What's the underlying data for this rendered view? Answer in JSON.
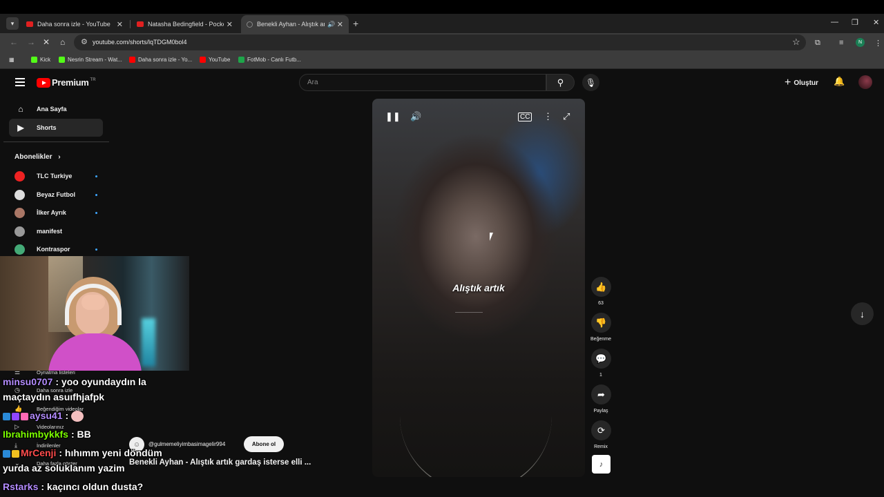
{
  "browser": {
    "tabs": [
      {
        "label": "Daha sonra izle - YouTube"
      },
      {
        "label": "Natasha Bedingfield - Pocketful"
      },
      {
        "label": "Benekli Ayhan - Alıştık artık"
      }
    ],
    "url": "youtube.com/shorts/lqTDGM0bol4",
    "profile_initial": "N",
    "bookmarks": [
      {
        "label": "Kick",
        "color": "#53fc18"
      },
      {
        "label": "Nesrin Stream - Wat...",
        "color": "#53fc18"
      },
      {
        "label": "Daha sonra izle - Yo...",
        "color": "#ff0000"
      },
      {
        "label": "YouTube",
        "color": "#ff0000"
      },
      {
        "label": "FotMob - Canlı Futb...",
        "color": "#1ea54a"
      }
    ]
  },
  "youtube": {
    "logo_text": "Premium",
    "logo_region": "TR",
    "search_placeholder": "Ara",
    "create_label": "Oluştur",
    "sidebar": {
      "items": [
        {
          "label": "Ana Sayfa",
          "icon": "home-icon"
        },
        {
          "label": "Shorts",
          "icon": "shorts-icon"
        }
      ],
      "subscriptions_header": "Abonelikler",
      "subscriptions": [
        {
          "label": "TLC Turkiye",
          "color": "#e22"
        },
        {
          "label": "Beyaz Futbol",
          "color": "#ddd"
        },
        {
          "label": "İlker Ayrık",
          "color": "#a76"
        },
        {
          "label": "manifest",
          "color": "#999"
        },
        {
          "label": "Kontraspor",
          "color": "#4a7"
        }
      ],
      "small_items": [
        {
          "label": "Oynatma listeleri"
        },
        {
          "label": "Daha sonra izle"
        },
        {
          "label": "Beğendiğim videolar"
        },
        {
          "label": "Videolarınız"
        },
        {
          "label": "İndirilenler"
        },
        {
          "label": "Daha fazla göster"
        }
      ]
    },
    "video": {
      "caption": "Alıştık artık",
      "channel": "@gulmemeliyimbasimagelir994",
      "subscribe_label": "Abone ol",
      "title": "Benekli Ayhan - Alıştık artık gardaş isterse elli ..."
    },
    "actions": {
      "likes": "63",
      "dislike_label": "Beğenme",
      "comments": "1",
      "share_label": "Paylaş",
      "remix_label": "Remix"
    }
  },
  "chat": [
    {
      "user": "minsu0707",
      "color": "#b48cff",
      "text": ": yoo oyundaydın la"
    },
    {
      "user": "",
      "color": "#ffffff",
      "text": "maçtaydın asuıfhjafpk"
    },
    {
      "user": "aysu41",
      "color": "#b48cff",
      "text": ":"
    },
    {
      "user": "Ibrahimbykkfs",
      "color": "#7cfc00",
      "text": ": BB"
    },
    {
      "user": "MrCenji",
      "color": "#ff4d4d",
      "text": ": hıhımm yeni döndüm"
    },
    {
      "user": "",
      "color": "#ffffff",
      "text": "yurda az soluklanım yazim"
    },
    {
      "user": "Rstarks",
      "color": "#b48cff",
      "text": ": kaçıncı oldun dusta?"
    }
  ]
}
